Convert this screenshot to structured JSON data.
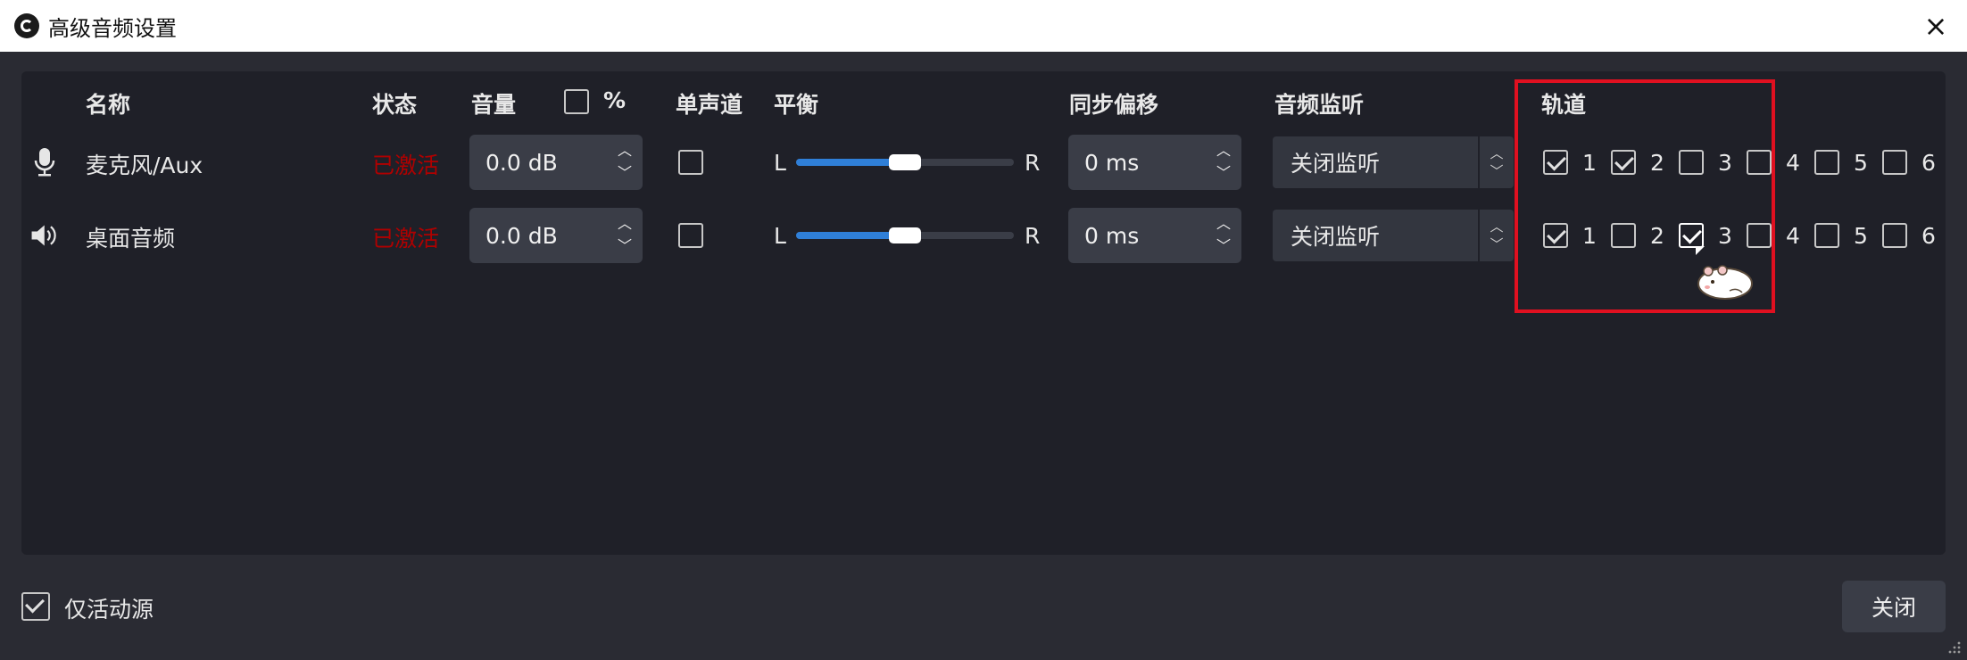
{
  "window": {
    "title": "高级音频设置",
    "close_icon": "×"
  },
  "headers": {
    "name": "名称",
    "status": "状态",
    "volume": "音量",
    "percent": "%",
    "mono": "单声道",
    "balance": "平衡",
    "sync_offset": "同步偏移",
    "monitoring": "音频监听",
    "tracks": "轨道"
  },
  "percent_checked": false,
  "rows": [
    {
      "icon": "microphone-icon",
      "name": "麦克风/Aux",
      "status": "已激活",
      "volume": "0.0 dB",
      "mono": false,
      "balance_left": "L",
      "balance_right": "R",
      "balance_value": 0.5,
      "sync": "0 ms",
      "monitor": "关闭监听",
      "tracks": [
        {
          "label": "1",
          "checked": true
        },
        {
          "label": "2",
          "checked": true
        },
        {
          "label": "3",
          "checked": false
        },
        {
          "label": "4",
          "checked": false
        },
        {
          "label": "5",
          "checked": false
        },
        {
          "label": "6",
          "checked": false
        }
      ]
    },
    {
      "icon": "speaker-icon",
      "name": "桌面音频",
      "status": "已激活",
      "volume": "0.0 dB",
      "mono": false,
      "balance_left": "L",
      "balance_right": "R",
      "balance_value": 0.5,
      "sync": "0 ms",
      "monitor": "关闭监听",
      "tracks": [
        {
          "label": "1",
          "checked": true
        },
        {
          "label": "2",
          "checked": false
        },
        {
          "label": "3",
          "checked": true
        },
        {
          "label": "4",
          "checked": false
        },
        {
          "label": "5",
          "checked": false
        },
        {
          "label": "6",
          "checked": false
        }
      ]
    }
  ],
  "footer": {
    "active_only_label": "仅活动源",
    "active_only_checked": true,
    "close_label": "关闭"
  },
  "colors": {
    "status": "#b00000",
    "slider_fill": "#2f7fd8",
    "highlight": "#e01020"
  }
}
